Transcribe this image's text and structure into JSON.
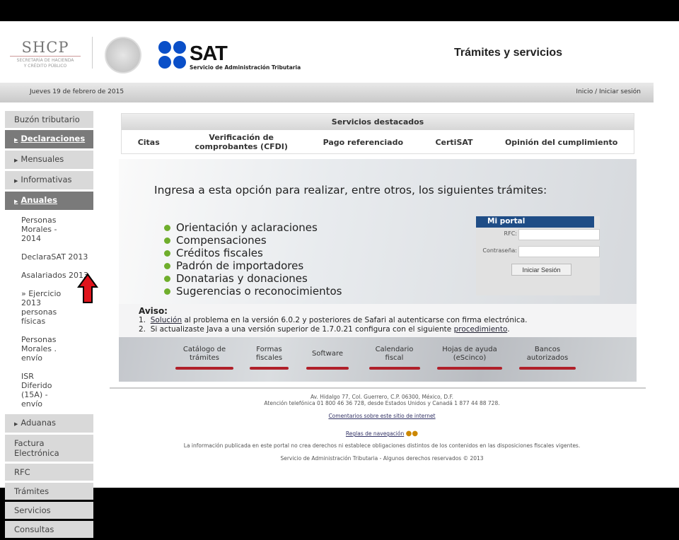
{
  "header": {
    "shcp": "SHCP",
    "shcp_sub1": "SECRETARÍA DE HACIENDA",
    "shcp_sub2": "Y CRÉDITO PÚBLICO",
    "sat": "SAT",
    "sat_sub": "Servicio de Administración Tributaria",
    "title": "Trámites y servicios",
    "date": "Jueves 19 de febrero de 2015",
    "login_link": "Inicio / Iniciar sesión",
    "brand_color": "#0a4fc8"
  },
  "sidebar": {
    "items": [
      "Buzón tributario",
      "Declaraciones",
      "Mensuales",
      "Informativas",
      "Anuales"
    ],
    "anuales_sub": [
      "Personas Morales - 2014",
      "DeclaraSAT 2013",
      "Asalariados 2013",
      "Ejercicio 2013 personas físicas",
      "Personas Morales . envío",
      "ISR Diferido (15A) - envío"
    ],
    "items_after": [
      "Aduanas",
      "Factura Electrónica",
      "RFC",
      "Trámites",
      "Servicios",
      "Consultas"
    ]
  },
  "featured": {
    "title": "Servicios destacados",
    "items": [
      "Citas",
      "Verificación de comprobantes (CFDI)",
      "Pago referenciado",
      "CertiSAT",
      "Opinión del cumplimiento"
    ]
  },
  "panel": {
    "intro": "Ingresa a esta opción para realizar, entre otros, los siguientes trámites:",
    "list": [
      "Orientación y aclaraciones",
      "Compensaciones",
      "Créditos fiscales",
      "Padrón de importadores",
      "Donatarias y donaciones",
      "Sugerencias o reconocimientos"
    ]
  },
  "portal": {
    "title": "Mi portal",
    "rfc_label": "RFC:",
    "password_label": "Contraseña:",
    "rfc_value": "",
    "password_value": "",
    "submit": "Iniciar Sesión"
  },
  "aviso": {
    "title": "Aviso:",
    "l1_link": "Solución",
    "l1_text": " al problema en la versión 6.0.2 y posteriores de Safari al autenticarse con firma electrónica.",
    "l2_text": "Si actualizaste Java a una versión superior de 1.7.0.21 configura con el siguiente ",
    "l2_link": "procedimiento"
  },
  "quicklinks": [
    "Catálogo de trámites",
    "Formas fiscales",
    "Software",
    "Calendario fiscal",
    "Hojas de ayuda (eScinco)",
    "Bancos autorizados"
  ],
  "footer": {
    "address": "Av. Hidalgo 77, Col. Guerrero, C.P. 06300, México, D.F.",
    "phone": "Atención telefónica 01 800 46 36 728, desde Estados Unidos y Canadá 1 877 44 88 728.",
    "comments": "Comentarios sobre este sitio de internet",
    "rules": "Reglas de navegación",
    "disclaimer": "La información publicada en este portal no crea derechos ni establece obligaciones distintos de los contenidos en las disposiciones fiscales vigentes.",
    "copyright": "Servicio de Administración Tributaria - Algunos derechos reservados © 2013"
  }
}
